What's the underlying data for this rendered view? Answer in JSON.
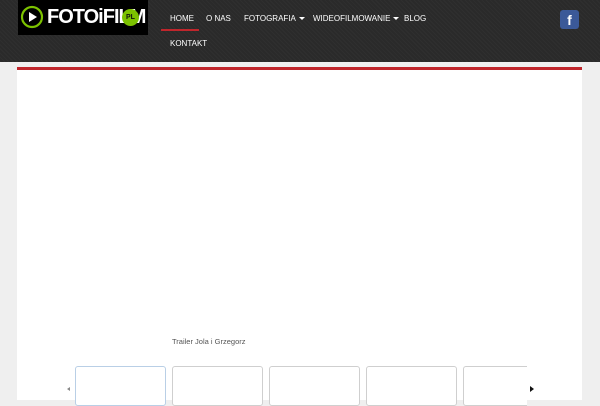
{
  "header": {
    "logo": {
      "text": "FOTOiFILM",
      "badge": "PL"
    },
    "facebook_glyph": "f"
  },
  "nav": {
    "items": [
      {
        "label": "HOME",
        "active": true,
        "dropdown": false
      },
      {
        "label": "O NAS",
        "active": false,
        "dropdown": false
      },
      {
        "label": "FOTOGRAFIA",
        "active": false,
        "dropdown": true
      },
      {
        "label": "WIDEOFILMOWANIE",
        "active": false,
        "dropdown": true
      },
      {
        "label": "BLOG",
        "active": false,
        "dropdown": false
      },
      {
        "label": "KONTAKT",
        "active": false,
        "dropdown": false
      }
    ]
  },
  "gallery": {
    "caption": "Trailer Jola i Grzegorz"
  },
  "colors": {
    "accent": "#c0262c",
    "header_bg": "#2a2a2a",
    "logo_green": "#7cc200",
    "facebook": "#3b5998"
  }
}
